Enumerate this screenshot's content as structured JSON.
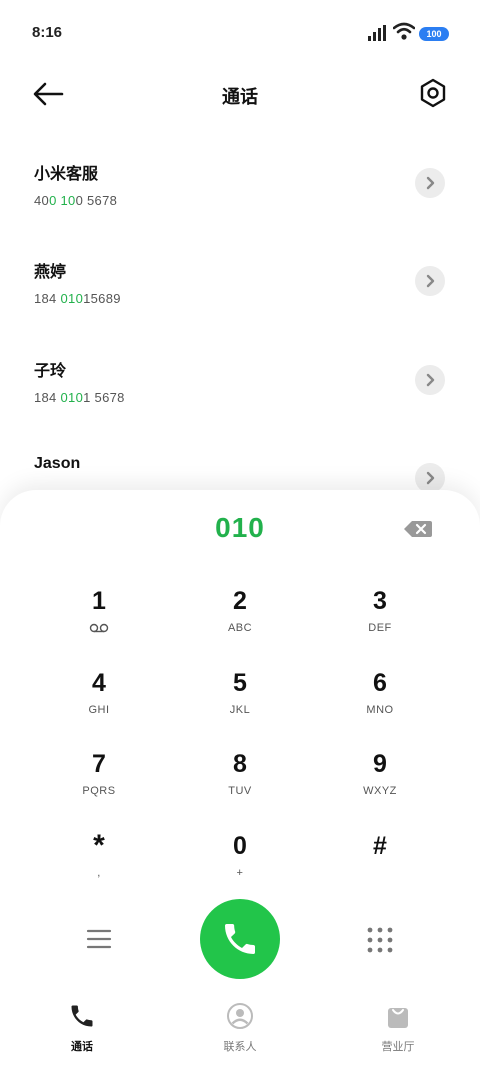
{
  "status_bar": {
    "time": "8:16",
    "battery": "100"
  },
  "header": {
    "title": "通话"
  },
  "contacts": [
    {
      "name": "小米客服",
      "number_parts": [
        "40",
        "0",
        " ",
        "10",
        "0",
        " 5678"
      ]
    },
    {
      "name": "燕婷",
      "number_parts": [
        "184 ",
        "010",
        "15689"
      ]
    },
    {
      "name": "子玲",
      "number_parts": [
        "184 ",
        "010",
        "1 5678"
      ]
    },
    {
      "name": "Jason",
      "number_parts": []
    }
  ],
  "dialer": {
    "input": "010",
    "keys": [
      {
        "digit": "1",
        "letters": ""
      },
      {
        "digit": "2",
        "letters": "ABC"
      },
      {
        "digit": "3",
        "letters": "DEF"
      },
      {
        "digit": "4",
        "letters": "GHI"
      },
      {
        "digit": "5",
        "letters": "JKL"
      },
      {
        "digit": "6",
        "letters": "MNO"
      },
      {
        "digit": "7",
        "letters": "PQRS"
      },
      {
        "digit": "8",
        "letters": "TUV"
      },
      {
        "digit": "9",
        "letters": "WXYZ"
      },
      {
        "digit": "*",
        "letters": ","
      },
      {
        "digit": "0",
        "letters": "+"
      },
      {
        "digit": "#",
        "letters": ""
      }
    ]
  },
  "tabs": [
    {
      "label": "通话",
      "icon": "phone-icon",
      "active": true
    },
    {
      "label": "联系人",
      "icon": "person-icon",
      "active": false
    },
    {
      "label": "营业厅",
      "icon": "bag-icon",
      "active": false
    }
  ],
  "colors": {
    "accent": "#22b14c",
    "call_button": "#22c54a",
    "battery": "#2b7ef2"
  }
}
